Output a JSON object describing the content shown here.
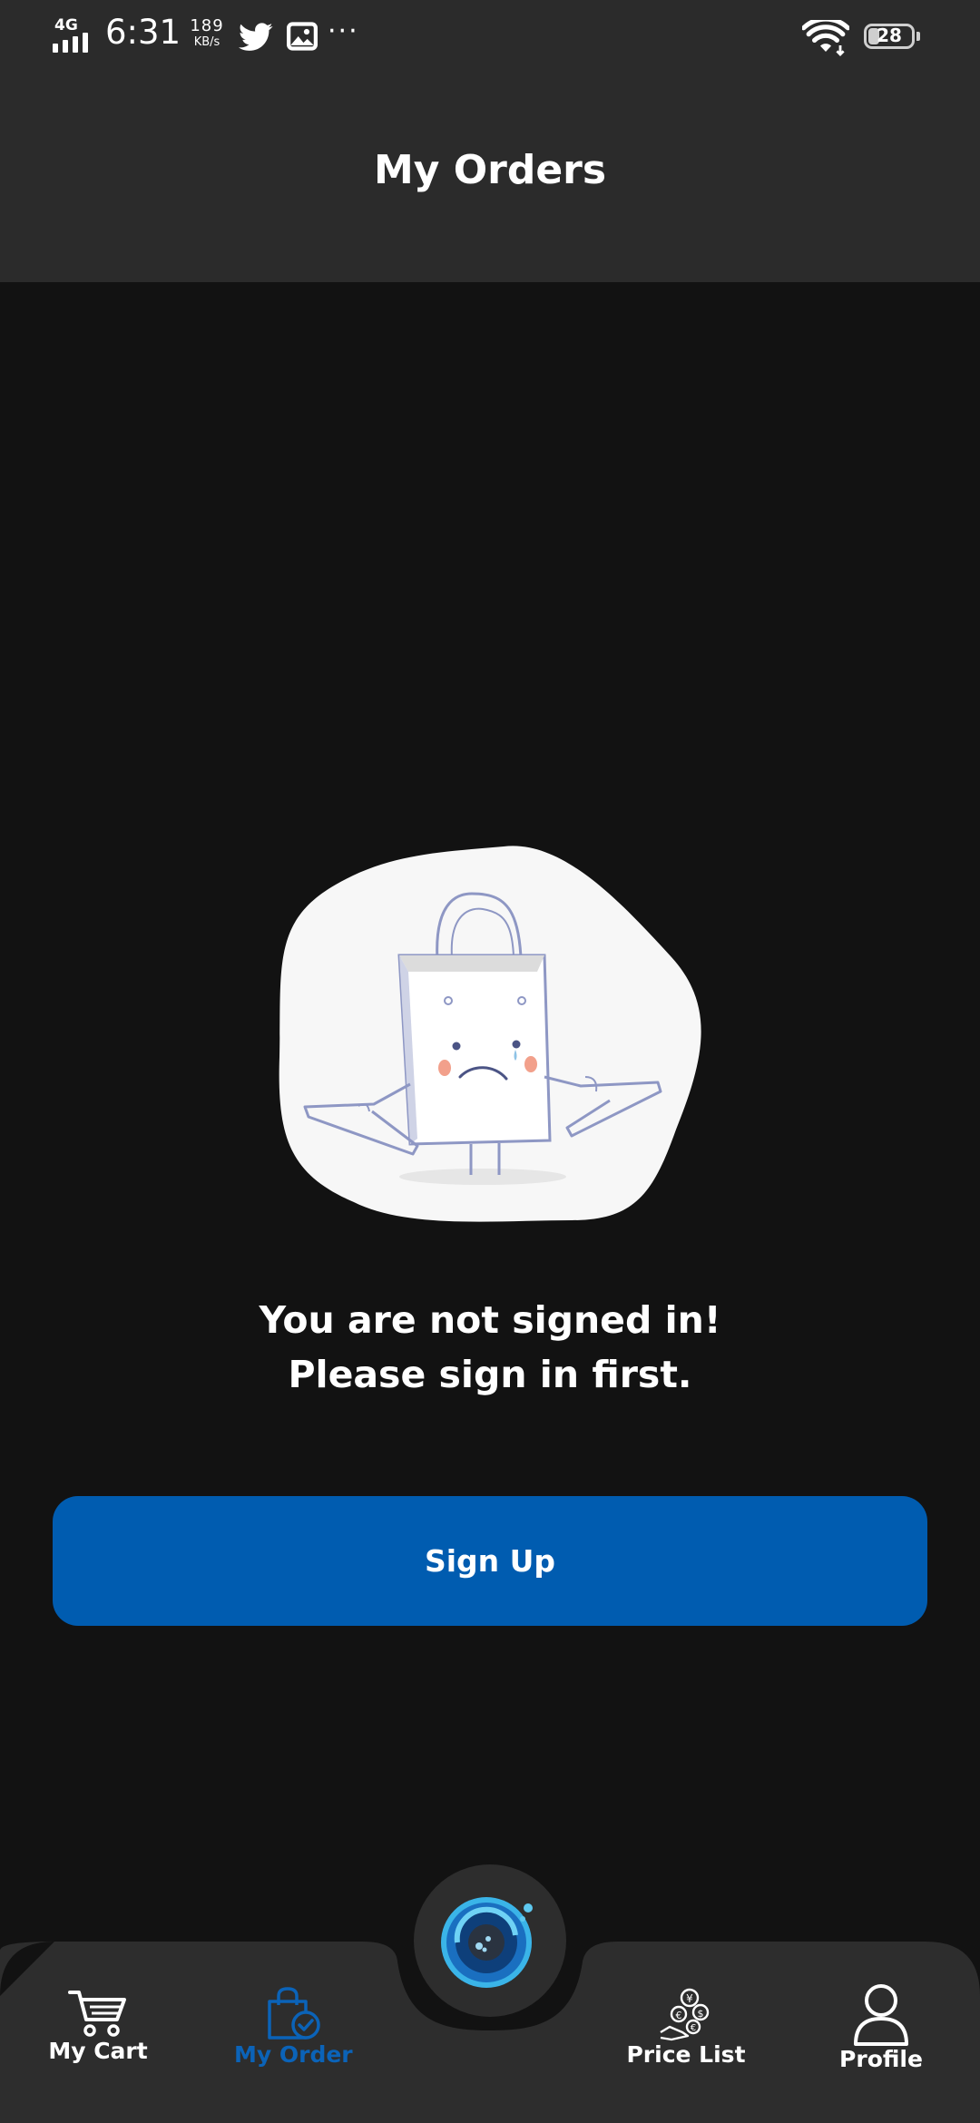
{
  "status_bar": {
    "network_type": "4G",
    "time": "6:31",
    "speed_value": "189",
    "speed_unit": "KB/s",
    "notification_icons": [
      "twitter-icon",
      "gallery-icon",
      "more-icon"
    ],
    "more": "···",
    "battery": "28"
  },
  "header": {
    "title": "My Orders"
  },
  "main": {
    "illustration": "sad-shopping-bag-illustration",
    "message_line1": "You are not signed in!",
    "message_line2": "Please sign in first.",
    "signup_label": "Sign Up"
  },
  "bottom_nav": {
    "items": [
      {
        "label": "My Cart",
        "icon": "cart-icon"
      },
      {
        "label": "My Order",
        "icon": "order-bag-icon",
        "active": true
      },
      {
        "label": "Price List",
        "icon": "currency-icon"
      },
      {
        "label": "Profile",
        "icon": "profile-icon"
      }
    ],
    "center_button_icon": "app-logo-icon"
  },
  "colors": {
    "background": "#121212",
    "bars": "#2b2b2b",
    "accent": "#005cb0",
    "active_nav": "#0b63b8"
  }
}
